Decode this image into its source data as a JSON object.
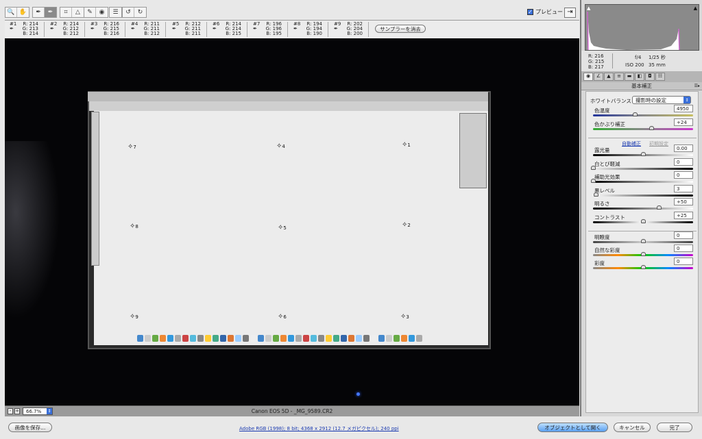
{
  "toolbar": {
    "tools": [
      "zoom-icon",
      "hand-icon",
      "white-balance-icon",
      "color-sampler-icon",
      "crop-icon",
      "straighten-icon",
      "retouch-icon",
      "red-eye-icon",
      "preferences-icon",
      "rotate-left-icon",
      "rotate-right-icon"
    ],
    "preview_label": "プレビュー",
    "preview_checked": true
  },
  "samplers": [
    {
      "num": "#1",
      "r": "R: 214",
      "g": "G: 213",
      "b": "B: 214"
    },
    {
      "num": "#2",
      "r": "R: 214",
      "g": "G: 212",
      "b": "B: 212"
    },
    {
      "num": "#3",
      "r": "R: 216",
      "g": "G: 215",
      "b": "B: 216"
    },
    {
      "num": "#4",
      "r": "R: 211",
      "g": "G: 211",
      "b": "B: 212"
    },
    {
      "num": "#5",
      "r": "R: 212",
      "g": "G: 211",
      "b": "B: 211"
    },
    {
      "num": "#6",
      "r": "R: 214",
      "g": "G: 214",
      "b": "B: 215"
    },
    {
      "num": "#7",
      "r": "R: 196",
      "g": "G: 196",
      "b": "B: 195"
    },
    {
      "num": "#8",
      "r": "R: 194",
      "g": "G: 194",
      "b": "B: 190"
    },
    {
      "num": "#9",
      "r": "R: 202",
      "g": "G: 204",
      "b": "B: 200"
    }
  ],
  "clear_samplers": "サンプラーを消去",
  "markers": [
    "7",
    "4",
    "1",
    "8",
    "5",
    "2",
    "9",
    "6",
    "3"
  ],
  "status": {
    "zoom": "66.7%",
    "filename": "Canon EOS 5D  -  _MG_9589.CR2"
  },
  "info": {
    "r": "R:  216",
    "g": "G:  215",
    "b": "B:  217",
    "aperture": "f/4",
    "shutter": "1/25 秒",
    "iso": "ISO 200",
    "focal": "35 mm"
  },
  "panel": {
    "title": "基本補正",
    "wb_label": "ホワイトバランス：",
    "wb_value": "撮影時の設定",
    "auto": "自動補正",
    "default": "初期設定",
    "sliders": [
      {
        "label": "色温度",
        "value": "4950",
        "pos": 0.42
      },
      {
        "label": "色かぶり補正",
        "value": "+24",
        "pos": 0.58
      },
      {
        "label": "露光量",
        "value": "0.00",
        "pos": 0.5
      },
      {
        "label": "白とび軽減",
        "value": "0",
        "pos": 0.0
      },
      {
        "label": "補助光効果",
        "value": "0",
        "pos": 0.0
      },
      {
        "label": "黒レベル",
        "value": "3",
        "pos": 0.03
      },
      {
        "label": "明るさ",
        "value": "+50",
        "pos": 0.66
      },
      {
        "label": "コントラスト",
        "value": "+25",
        "pos": 0.5
      },
      {
        "label": "明瞭度",
        "value": "0",
        "pos": 0.5
      },
      {
        "label": "自然な彩度",
        "value": "0",
        "pos": 0.5
      },
      {
        "label": "彩度",
        "value": "0",
        "pos": 0.5
      }
    ]
  },
  "footer": {
    "save": "画像を保存...",
    "workflow": "Adobe RGB (1998); 8 bit; 4368 x 2912 (12.7 メガピクセル); 240 ppi",
    "open": "オブジェクトとして開く",
    "cancel": "キャンセル",
    "done": "完了"
  }
}
